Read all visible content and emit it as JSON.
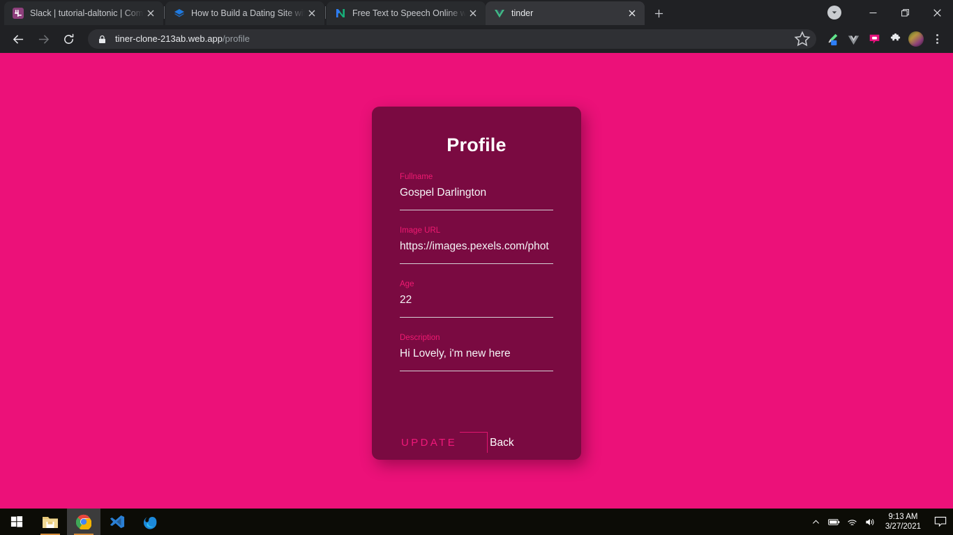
{
  "browser": {
    "tabs": [
      {
        "title": "Slack | tutorial-daltonic | CometC",
        "favicon": "slack-icon",
        "active": false
      },
      {
        "title": "How to Build a Dating Site with V",
        "favicon": "layers-icon",
        "active": false
      },
      {
        "title": "Free Text to Speech Online with N",
        "favicon": "natural-reader-icon",
        "active": false
      },
      {
        "title": "tinder",
        "favicon": "vue-icon",
        "active": true
      }
    ],
    "new_tab_label": "+",
    "window_controls": {
      "download": "chevron-down-circle-icon",
      "minimize": "minimize-icon",
      "maximize": "maximize-icon",
      "close": "close-icon"
    },
    "toolbar": {
      "back": "back-arrow-icon",
      "forward": "forward-arrow-icon",
      "reload": "reload-icon",
      "lock": "lock-icon",
      "url_domain": "tiner-clone-213ab.web.app",
      "url_path": "/profile",
      "bookmark": "star-icon",
      "extensions": [
        "eyedropper-icon",
        "vue-devtools-icon",
        "screen-recorder-icon",
        "puzzle-piece-icon"
      ],
      "avatar": "profile-avatar",
      "menu": "three-dot-menu-icon"
    }
  },
  "page": {
    "title": "Profile",
    "fields": [
      {
        "label": "Fullname",
        "value": "Gospel Darlington"
      },
      {
        "label": "Image URL",
        "value": "https://images.pexels.com/phot"
      },
      {
        "label": "Age",
        "value": "22"
      },
      {
        "label": "Description",
        "value": "Hi Lovely, i'm new here"
      }
    ],
    "actions": {
      "update_label": "UPDATE",
      "back_label": "Back"
    },
    "colors": {
      "background": "#ec1179",
      "card": "#7a0a41",
      "label": "#f01a72",
      "value": "#f4f4f6",
      "accent": "#f0187a"
    }
  },
  "taskbar": {
    "items": [
      {
        "name": "start-button",
        "icon": "windows-logo-icon",
        "active": false
      },
      {
        "name": "file-explorer",
        "icon": "folder-icon",
        "active": false
      },
      {
        "name": "google-chrome",
        "icon": "chrome-icon",
        "active": true
      },
      {
        "name": "vs-code",
        "icon": "vscode-icon",
        "active": false
      },
      {
        "name": "microsoft-edge",
        "icon": "edge-icon",
        "active": false
      }
    ],
    "tray": {
      "show_hidden": "chevron-up-icon",
      "battery": "battery-icon",
      "wifi": "wifi-icon",
      "volume": "speaker-icon",
      "time": "9:13 AM",
      "date": "3/27/2021",
      "action_center": "notification-icon"
    }
  }
}
